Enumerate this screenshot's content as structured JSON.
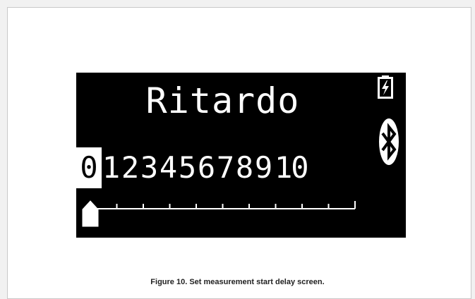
{
  "screen": {
    "title": "Ritardo",
    "delay_scale": {
      "digits": [
        "0",
        "1",
        "2",
        "3",
        "4",
        "5",
        "6",
        "7",
        "8",
        "9",
        "10"
      ],
      "selected_value": 0,
      "max_value": 10
    },
    "icons": [
      "battery-charging-icon",
      "bluetooth-icon",
      "slider-pointer-icon"
    ]
  },
  "caption": "Figure 10. Set measurement start delay screen.",
  "colors": {
    "screen_bg": "#000000",
    "foreground": "#ffffff",
    "page_bg": "#f1f1f1"
  }
}
